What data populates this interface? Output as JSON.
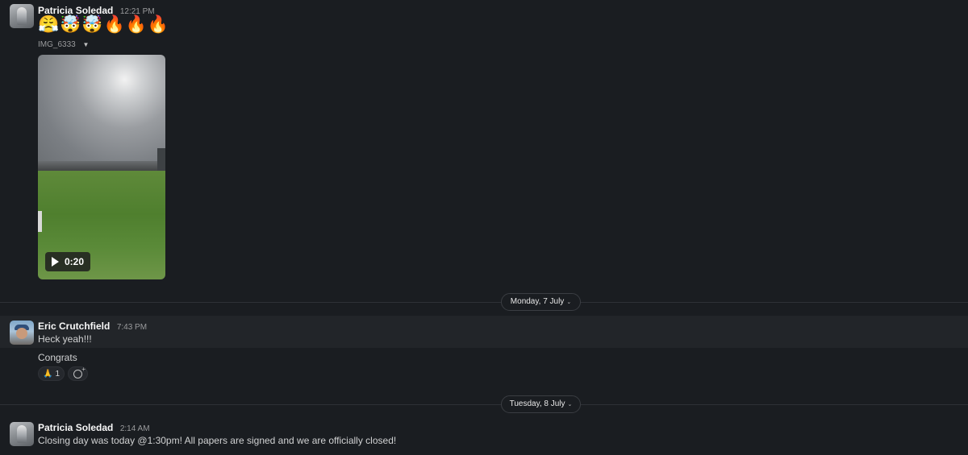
{
  "messages": [
    {
      "author": "Patricia Soledad",
      "time": "12:21 PM",
      "emojis": "😤🤯🤯🔥🔥🔥",
      "file": {
        "name": "IMG_6333",
        "caret": "▼",
        "duration": "0:20"
      }
    },
    {
      "author": "Eric Crutchfield",
      "time": "7:43 PM",
      "lines": [
        "Heck yeah!!!",
        "Congrats"
      ],
      "reactions": [
        {
          "emoji": "🙏",
          "count": "1"
        }
      ]
    },
    {
      "author": "Patricia Soledad",
      "time": "2:14 AM",
      "lines": [
        "Closing day was today @1:30pm! All papers are signed and we are officially closed!"
      ]
    }
  ],
  "date_dividers": [
    {
      "label": "Monday, 7 July",
      "chevron": "⌄"
    },
    {
      "label": "Tuesday, 8 July",
      "chevron": "⌄"
    }
  ],
  "icons": {
    "play": "play-icon",
    "add_reaction": "add-reaction-icon",
    "caret": "caret-down-icon"
  },
  "colors": {
    "background": "#1a1d21",
    "hover_band": "#222529",
    "author": "#f8f8f8",
    "muted": "#9a9b9d"
  }
}
